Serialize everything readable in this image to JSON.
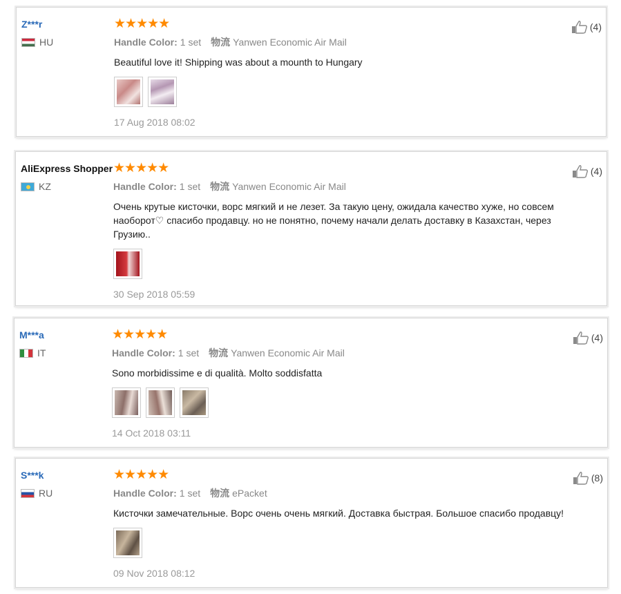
{
  "reviews": [
    {
      "username": "Z***r",
      "country": "HU",
      "stars": "★★★★★",
      "handle_label": "Handle Color:",
      "handle_value": "1 set",
      "logistics_label": "物流",
      "logistics_value": "Yanwen Economic Air Mail",
      "text": "Beautiful love it! Shipping was about a mounth to Hungary",
      "date": "17 Aug 2018 08:02",
      "likes": "(4)",
      "photos": 2
    },
    {
      "username": "AliExpress Shopper",
      "country": "KZ",
      "stars": "★★★★★",
      "handle_label": "Handle Color:",
      "handle_value": "1 set",
      "logistics_label": "物流",
      "logistics_value": "Yanwen Economic Air Mail",
      "text": "Очень крутые кисточки, ворс мягкий и не лезет. За такую цену, ожидала качество хуже, но совсем наоборот♡ спасибо продавцу. но не понятно, почему начали делать доставку в Казахстан, через Грузию..",
      "date": "30 Sep 2018 05:59",
      "likes": "(4)",
      "photos": 1
    },
    {
      "username": "M***a",
      "country": "IT",
      "stars": "★★★★★",
      "handle_label": "Handle Color:",
      "handle_value": "1 set",
      "logistics_label": "物流",
      "logistics_value": "Yanwen Economic Air Mail",
      "text": "Sono morbidissime e di qualità. Molto soddisfatta",
      "date": "14 Oct 2018 03:11",
      "likes": "(4)",
      "photos": 3
    },
    {
      "username": "S***k",
      "country": "RU",
      "stars": "★★★★★",
      "handle_label": "Handle Color:",
      "handle_value": "1 set",
      "logistics_label": "物流",
      "logistics_value": "ePacket",
      "text": "Кисточки замечательные. Ворс очень очень мягкий. Доставка быстрая. Большое спасибо продавцу!",
      "date": "09 Nov 2018 08:12",
      "likes": "(8)",
      "photos": 1
    }
  ],
  "colors": {
    "star": "#ff8a00",
    "username_link": "#2a6ab8",
    "muted_text": "#888888"
  },
  "icons": {
    "like": "thumbs-up-icon",
    "flag": "country-flag-icon",
    "rating": "star-icon"
  }
}
